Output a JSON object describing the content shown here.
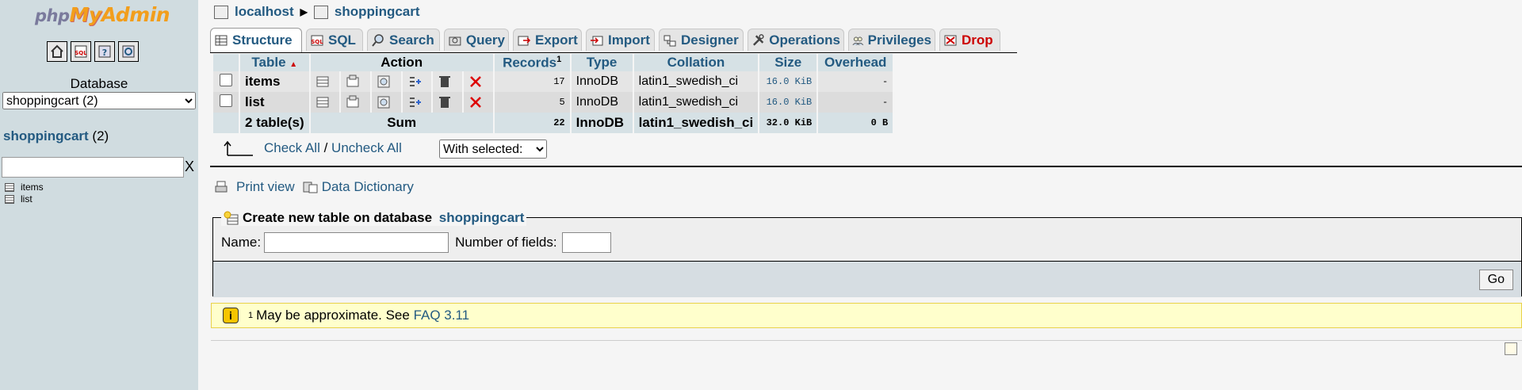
{
  "nav": {
    "logo": {
      "php": "php",
      "my": "My",
      "admin": "Admin"
    },
    "icons": [
      "home-icon",
      "sql-query-icon",
      "help-icon",
      "docs-icon"
    ],
    "db_label": "Database",
    "db_select": "shoppingcart (2)",
    "db_title": "shoppingcart",
    "db_count": "(2)",
    "filter_clear": "X",
    "tables": [
      "items",
      "list"
    ]
  },
  "breadcrumb": {
    "server": "localhost",
    "database": "shoppingcart"
  },
  "tabs": [
    {
      "label": "Structure",
      "icon": "structure-icon"
    },
    {
      "label": "SQL",
      "icon": "sql-icon"
    },
    {
      "label": "Search",
      "icon": "search-icon"
    },
    {
      "label": "Query",
      "icon": "query-icon"
    },
    {
      "label": "Export",
      "icon": "export-icon"
    },
    {
      "label": "Import",
      "icon": "import-icon"
    },
    {
      "label": "Designer",
      "icon": "designer-icon"
    },
    {
      "label": "Operations",
      "icon": "operations-icon"
    },
    {
      "label": "Privileges",
      "icon": "privileges-icon"
    },
    {
      "label": "Drop",
      "icon": "drop-icon"
    }
  ],
  "table": {
    "headers": {
      "table": "Table",
      "action": "Action",
      "records": "Records",
      "records_sup": "1",
      "type": "Type",
      "collation": "Collation",
      "size": "Size",
      "overhead": "Overhead"
    },
    "rows": [
      {
        "name": "items",
        "records": "17",
        "type": "InnoDB",
        "collation": "latin1_swedish_ci",
        "size": "16.0 KiB",
        "overhead": "-"
      },
      {
        "name": "list",
        "records": "5",
        "type": "InnoDB",
        "collation": "latin1_swedish_ci",
        "size": "16.0 KiB",
        "overhead": "-"
      }
    ],
    "sum": {
      "label": "2 table(s)",
      "sum": "Sum",
      "records": "22",
      "type": "InnoDB",
      "collation": "latin1_swedish_ci",
      "size": "32.0 KiB",
      "overhead": "0 B"
    }
  },
  "selection": {
    "check_all": "Check All",
    "separator": " / ",
    "uncheck_all": "Uncheck All",
    "with_selected": "With selected:"
  },
  "links": {
    "print_view": "Print view",
    "data_dictionary": "Data Dictionary"
  },
  "create": {
    "legend": "Create new table on database ",
    "db": "shoppingcart",
    "name_label": "Name:",
    "fields_label": "Number of fields:",
    "go": "Go"
  },
  "notice": {
    "marker": "1",
    "text": "May be approximate. See ",
    "link": "FAQ 3.11"
  }
}
